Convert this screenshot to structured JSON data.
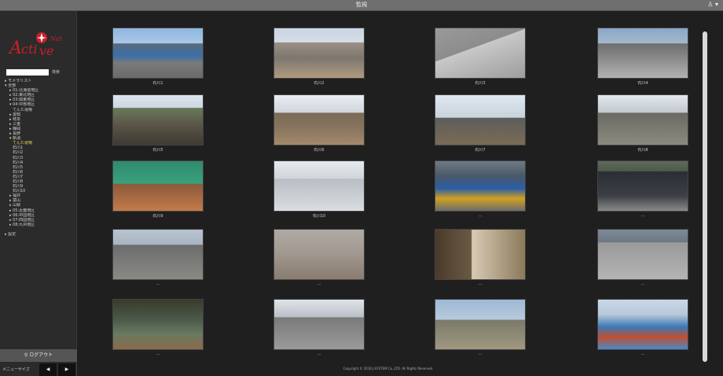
{
  "topbar": {
    "title": "監視",
    "user_icon": "user-icon",
    "user_caret": "▾"
  },
  "sidebar": {
    "brand_text": "Active Net",
    "search_button": "検索",
    "tree": [
      {
        "label": "▸ モメラリスト",
        "level": 0,
        "gap": false,
        "active": false
      },
      {
        "label": "▾ 全部",
        "level": 0,
        "gap": false,
        "active": false
      },
      {
        "label": "▸ 01:北海道地区",
        "level": 1,
        "gap": false,
        "active": false
      },
      {
        "label": "▸ 02:東北地区",
        "level": 1,
        "gap": false,
        "active": false
      },
      {
        "label": "▸ 03:関東地区",
        "level": 1,
        "gap": false,
        "active": false
      },
      {
        "label": "▾ 04:中部地区",
        "level": 1,
        "gap": false,
        "active": false
      },
      {
        "label": "てんた現場",
        "level": 2,
        "gap": false,
        "active": false
      },
      {
        "label": "▸ 愛知",
        "level": 1,
        "gap": false,
        "active": false
      },
      {
        "label": "▸ 岐阜",
        "level": 1,
        "gap": false,
        "active": false
      },
      {
        "label": "▸ 三重",
        "level": 1,
        "gap": false,
        "active": false
      },
      {
        "label": "▸ 静岡",
        "level": 1,
        "gap": false,
        "active": false
      },
      {
        "label": "▸ 長野",
        "level": 1,
        "gap": false,
        "active": false
      },
      {
        "label": "▾ 新潟",
        "level": 1,
        "gap": false,
        "active": false
      },
      {
        "label": "てんた現場",
        "level": 2,
        "gap": false,
        "active": true
      },
      {
        "label": "石川1",
        "level": 2,
        "gap": false,
        "active": false
      },
      {
        "label": "石川2",
        "level": 2,
        "gap": false,
        "active": false
      },
      {
        "label": "石川3",
        "level": 2,
        "gap": false,
        "active": false
      },
      {
        "label": "石川4",
        "level": 2,
        "gap": false,
        "active": false
      },
      {
        "label": "石川5",
        "level": 2,
        "gap": false,
        "active": false
      },
      {
        "label": "石川6",
        "level": 2,
        "gap": false,
        "active": false
      },
      {
        "label": "石川7",
        "level": 2,
        "gap": false,
        "active": false
      },
      {
        "label": "石川8",
        "level": 2,
        "gap": false,
        "active": false
      },
      {
        "label": "石川9",
        "level": 2,
        "gap": false,
        "active": false
      },
      {
        "label": "石川10",
        "level": 2,
        "gap": false,
        "active": false
      },
      {
        "label": "▸ 福井",
        "level": 1,
        "gap": false,
        "active": false
      },
      {
        "label": "▸ 富山",
        "level": 1,
        "gap": false,
        "active": false
      },
      {
        "label": "▸ 山梨",
        "level": 1,
        "gap": false,
        "active": false
      },
      {
        "label": "▸ 05:近畿地区",
        "level": 1,
        "gap": false,
        "active": false
      },
      {
        "label": "▸ 06:中国地区",
        "level": 1,
        "gap": false,
        "active": false
      },
      {
        "label": "▸ 07:四国地区",
        "level": 1,
        "gap": false,
        "active": false
      },
      {
        "label": "▸ 08:九州地区",
        "level": 1,
        "gap": false,
        "active": false
      },
      {
        "label": "▸ 設定",
        "level": 0,
        "gap": true,
        "active": false
      }
    ],
    "logout_label": "ログアウト",
    "logout_icon": "search-icon",
    "menu_size_label": "メニューサイズ",
    "prev_arrow": "◀",
    "next_arrow": "▶"
  },
  "cameras": [
    {
      "caption": "石川1",
      "scene": "street"
    },
    {
      "caption": "石川2",
      "scene": "houses"
    },
    {
      "caption": "石川3",
      "scene": "road"
    },
    {
      "caption": "石川4",
      "scene": "site"
    },
    {
      "caption": "石川5",
      "scene": "dirt"
    },
    {
      "caption": "石川6",
      "scene": "car"
    },
    {
      "caption": "石川7",
      "scene": "city"
    },
    {
      "caption": "石川8",
      "scene": "trucks"
    },
    {
      "caption": "石川9",
      "scene": "green"
    },
    {
      "caption": "石川10",
      "scene": "fence"
    },
    {
      "caption": "…",
      "scene": "machines"
    },
    {
      "caption": "…",
      "scene": "parking"
    },
    {
      "caption": "…",
      "scene": "yard"
    },
    {
      "caption": "…",
      "scene": "fog"
    },
    {
      "caption": "…",
      "scene": "garage"
    },
    {
      "caption": "…",
      "scene": "lot"
    },
    {
      "caption": "…",
      "scene": "interior"
    },
    {
      "caption": "…",
      "scene": "alley"
    },
    {
      "caption": "…",
      "scene": "open"
    },
    {
      "caption": "…",
      "scene": "blue"
    }
  ],
  "footer": "Copyright © 2016 J-SYSTEM Co.,LTD. All Rights Reserved.",
  "colors": {
    "accent_red": "#c8202a",
    "active_tree": "#e8d24a"
  }
}
